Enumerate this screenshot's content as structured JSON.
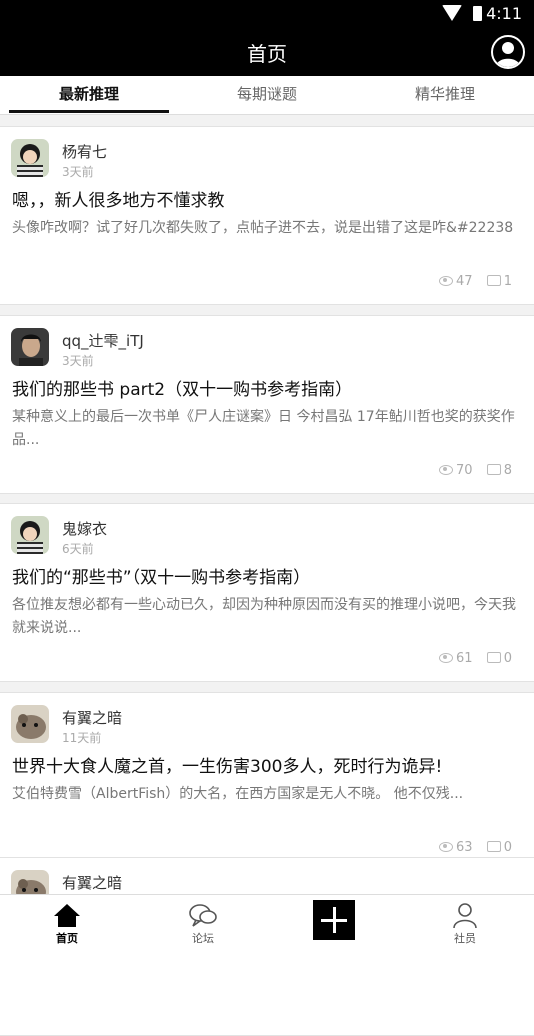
{
  "status_bar": {
    "time": "4:11"
  },
  "header": {
    "title": "首页"
  },
  "tabs": [
    {
      "label": "最新推理",
      "active": true
    },
    {
      "label": "每期谜题",
      "active": false
    },
    {
      "label": "精华推理",
      "active": false
    }
  ],
  "posts": [
    {
      "author": "杨宥七",
      "time": "3天前",
      "title": "嗯，，新人很多地方不懂求教",
      "excerpt": "头像咋改啊？试了好几次都失败了，点帖子进不去，说是出错了这是咋&#22238",
      "views": "47",
      "comments": "1",
      "avatar": "avatar-boy"
    },
    {
      "author": "qq_辻雫_iTJ",
      "time": "3天前",
      "title": "我们的那些书 part2（双十一购书参考指南）",
      "excerpt": "某种意义上的最后一次书单《尸人庄谜案》日 今村昌弘  17年鲇川哲也奖的获奖作品...",
      "views": "70",
      "comments": "8",
      "avatar": "avatar-man"
    },
    {
      "author": "鬼嫁衣",
      "time": "6天前",
      "title": "我们的“那些书”（双十一购书参考指南）",
      "excerpt": "各位推友想必都有一些心动已久，却因为种种原因而没有买的推理小说吧，今天我就来说说...",
      "views": "61",
      "comments": "0",
      "avatar": "avatar-boy"
    },
    {
      "author": "有翼之暗",
      "time": "11天前",
      "title": "世界十大食人魔之首，一生伤害300多人，死时行为诡异!",
      "excerpt": "艾伯特费雪（AlbertFish）的大名，在西方国家是无人不晓。   他不仅残...",
      "views": "63",
      "comments": "0",
      "avatar": "avatar-animal"
    },
    {
      "author": "有翼之暗",
      "time": "",
      "title": "",
      "excerpt": "",
      "views": "",
      "comments": "",
      "avatar": "avatar-animal"
    }
  ],
  "bottom_nav": [
    {
      "label": "首页",
      "icon": "home-icon",
      "active": true
    },
    {
      "label": "论坛",
      "icon": "chat-bubbles-icon",
      "active": false
    },
    {
      "label": "",
      "icon": "plus-icon",
      "active": false
    },
    {
      "label": "社员",
      "icon": "person-icon",
      "active": false
    }
  ],
  "colors": {
    "header_bg": "#000000",
    "accent": "#111111",
    "muted": "#aaaaaa"
  }
}
